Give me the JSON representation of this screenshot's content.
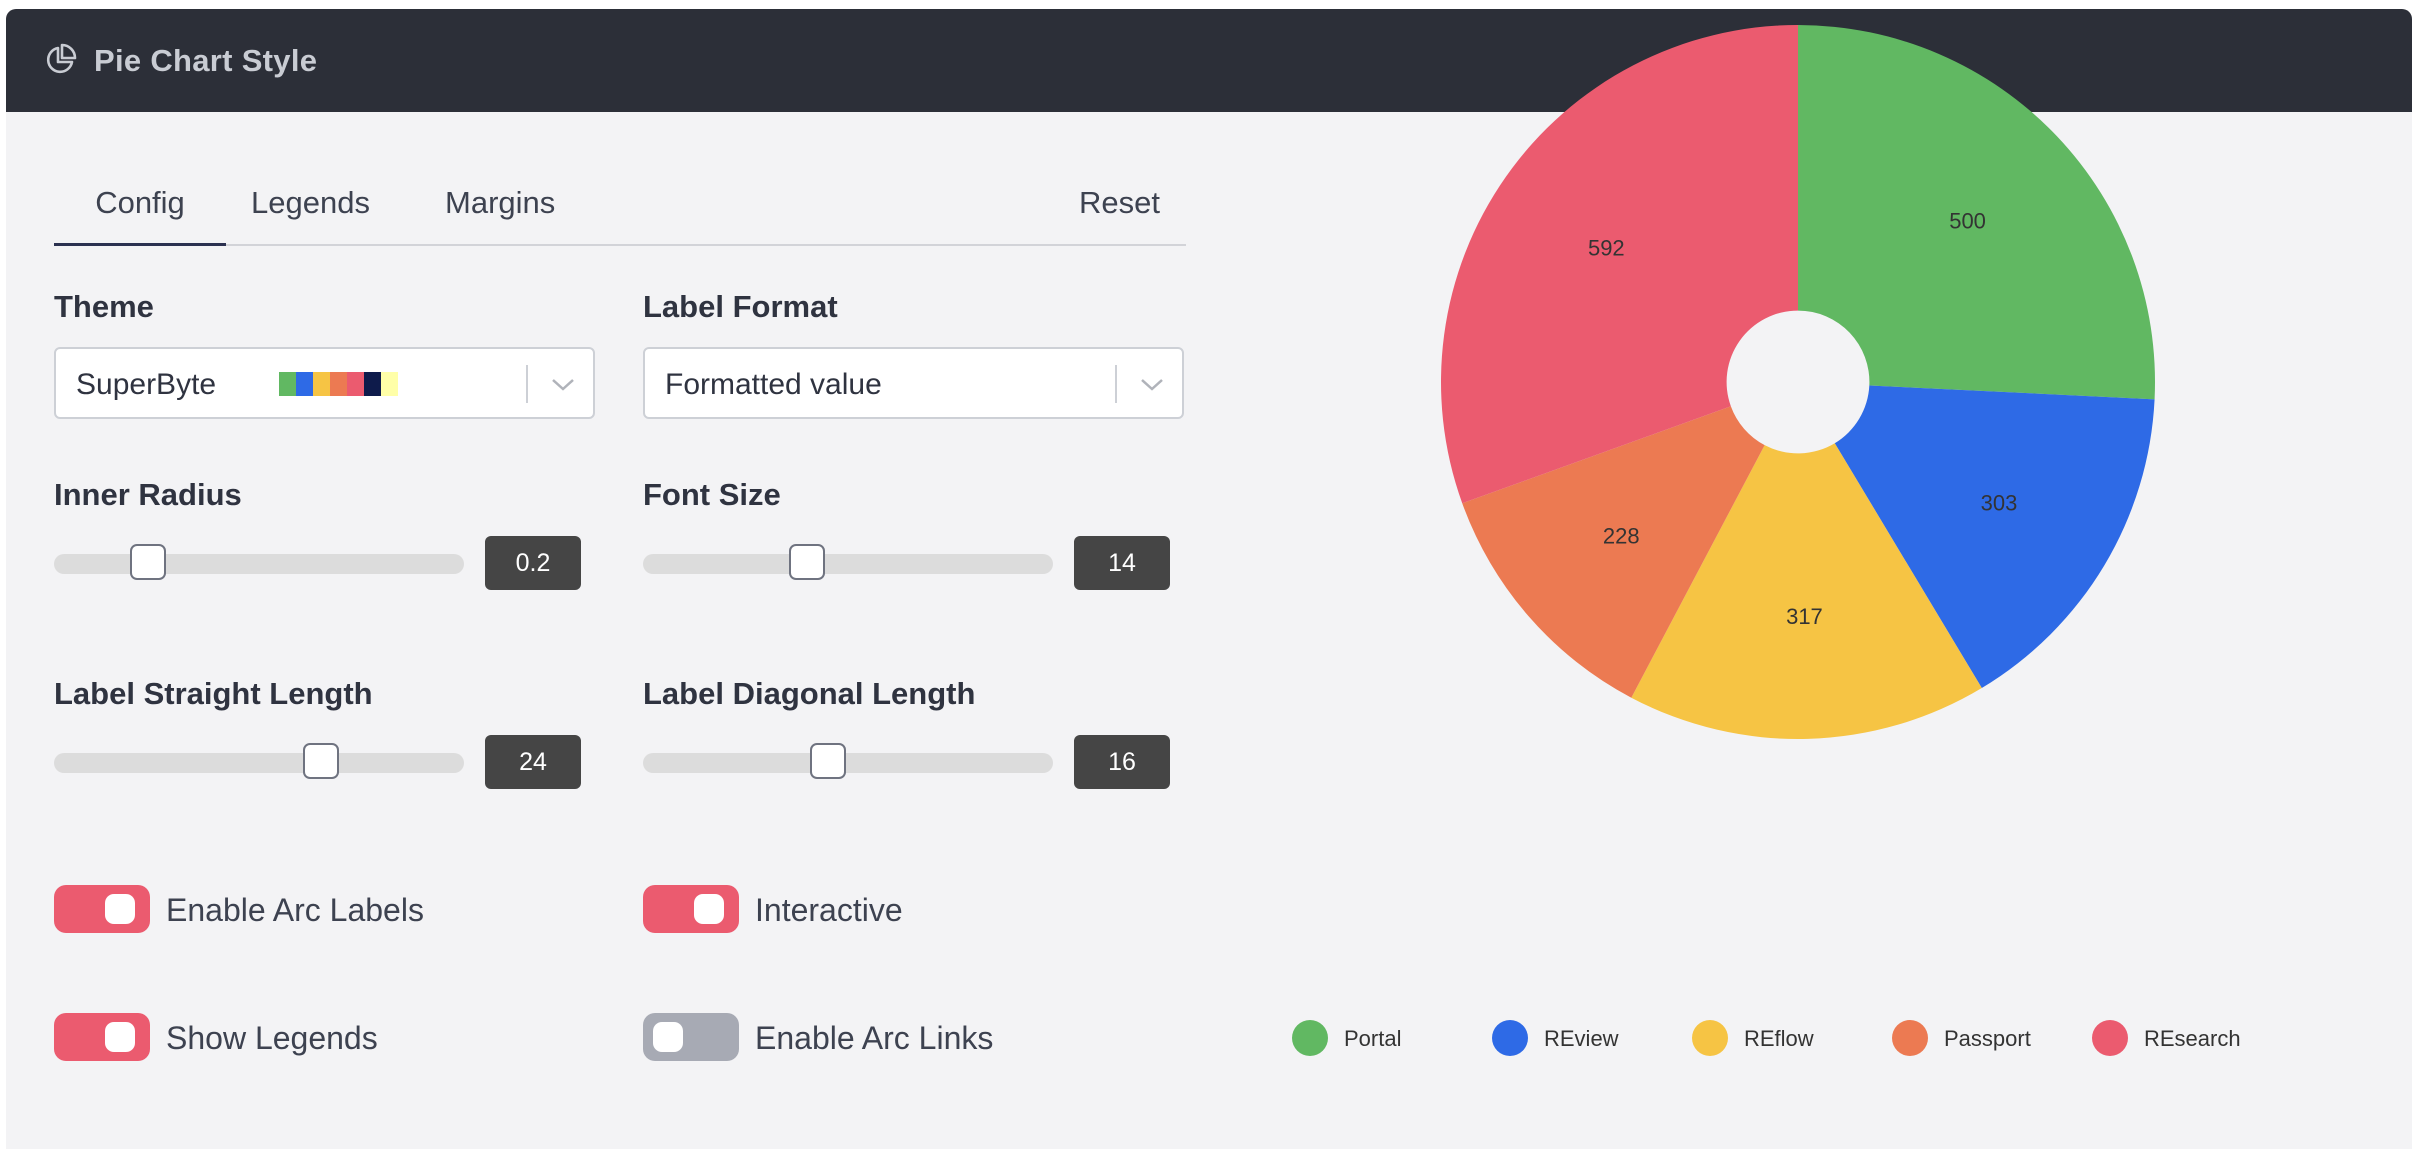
{
  "header": {
    "title": "Pie Chart Style",
    "icon": "pie-chart-icon"
  },
  "tabs": {
    "config": "Config",
    "legends": "Legends",
    "margins": "Margins",
    "active": "config",
    "reset": "Reset"
  },
  "config": {
    "theme": {
      "label": "Theme",
      "value": "SuperByte",
      "swatches": [
        "#61b862",
        "#2e6ae6",
        "#f6c444",
        "#ec7a52",
        "#eb5b6f",
        "#0e1b4b",
        "#ffffa8"
      ]
    },
    "label_format": {
      "label": "Label Format",
      "value": "Formatted value"
    },
    "inner_radius": {
      "label": "Inner Radius",
      "value": "0.2",
      "fraction": 0.23
    },
    "font_size": {
      "label": "Font Size",
      "value": "14",
      "fraction": 0.4
    },
    "label_straight_length": {
      "label": "Label Straight Length",
      "value": "24",
      "fraction": 0.65
    },
    "label_diagonal_length": {
      "label": "Label Diagonal Length",
      "value": "16",
      "fraction": 0.45
    },
    "toggles": {
      "enable_arc_labels": {
        "label": "Enable Arc Labels",
        "on": true
      },
      "interactive": {
        "label": "Interactive",
        "on": true
      },
      "show_legends": {
        "label": "Show Legends",
        "on": true
      },
      "enable_arc_links": {
        "label": "Enable Arc Links",
        "on": false
      }
    }
  },
  "colors": {
    "toggle_on": "#eb5b6f",
    "toggle_off": "#a7aab4",
    "header_bg": "#2c2f38"
  },
  "chart_data": {
    "type": "pie",
    "inner_radius": 0.2,
    "categories": [
      "Portal",
      "REview",
      "REflow",
      "Passport",
      "REsearch"
    ],
    "values": [
      500,
      303,
      317,
      228,
      592
    ],
    "colors": [
      "#61b862",
      "#2e6ae6",
      "#f6c444",
      "#ec7a52",
      "#eb5b6f"
    ],
    "arc_labels": [
      "500",
      "303",
      "317",
      "228",
      "592"
    ],
    "legend_placement": "bottom"
  }
}
